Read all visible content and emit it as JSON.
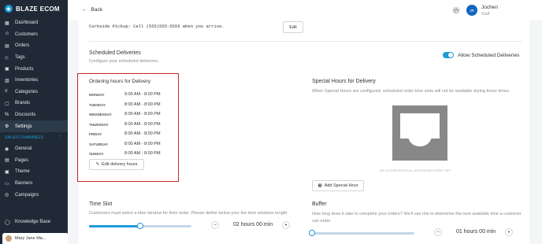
{
  "brand": {
    "name": "BLAZE ECOM"
  },
  "sidebar": {
    "items": [
      {
        "label": "Dashboard",
        "icon": "dashboard-icon"
      },
      {
        "label": "Customers",
        "icon": "customers-icon"
      },
      {
        "label": "Orders",
        "icon": "orders-icon"
      },
      {
        "label": "Tags",
        "icon": "tags-icon"
      },
      {
        "label": "Products",
        "icon": "products-icon"
      },
      {
        "label": "Inventories",
        "icon": "inventories-icon"
      },
      {
        "label": "Categories",
        "icon": "categories-icon"
      },
      {
        "label": "Brands",
        "icon": "brands-icon"
      },
      {
        "label": "Discounts",
        "icon": "discounts-icon"
      },
      {
        "label": "Settings",
        "icon": "settings-icon",
        "active": true
      }
    ],
    "sales_channels_label": "SALES CHANNELS",
    "channel_items": [
      {
        "label": "General"
      },
      {
        "label": "Pages"
      },
      {
        "label": "Theme"
      },
      {
        "label": "Banners"
      },
      {
        "label": "Campaigns"
      }
    ],
    "knowledge_base": "Knowledge Base",
    "user_name": "Mary Jane Ma..."
  },
  "topbar": {
    "back_label": "Back",
    "avatar_initials": "JR",
    "user_name": "Jochen",
    "user_role": "Staff"
  },
  "pickup": {
    "text": "Curbside Pickup: Call (555)555-5555 when you arrive.",
    "edit_label": "Edit"
  },
  "scheduled": {
    "title": "Scheduled Deliveries",
    "subtitle": "Configure your scheduled deliveries.",
    "toggle_label": "Allow Scheduled Deliveries",
    "toggle_on": true
  },
  "ordering_hours": {
    "title": "Ordering hours for Delivery",
    "rows": [
      {
        "day": "MONDAY",
        "hours": "9:00 AM - 8:00 PM"
      },
      {
        "day": "TUESDAY",
        "hours": "8:00 AM - 8:00 PM"
      },
      {
        "day": "WEDNESDAY",
        "hours": "8:00 AM - 8:00 PM"
      },
      {
        "day": "THURSDAY",
        "hours": "8:00 AM - 8:00 PM"
      },
      {
        "day": "FRIDAY",
        "hours": "8:00 AM - 8:00 PM"
      },
      {
        "day": "SATURDAY",
        "hours": "8:00 AM - 8:00 PM"
      },
      {
        "day": "SUNDAY",
        "hours": "8:00 AM - 8:00 PM"
      }
    ],
    "edit_label": "Edit delivery hours"
  },
  "special_hours": {
    "title": "Special Hours for Delivery",
    "subtitle": "When Special Hours are configured, scheduled order time slots will not be available during those times.",
    "empty_caption": "NO STORE/SPECIAL HOURS/DELIVERY SET",
    "add_label": "Add Special Hour"
  },
  "time_slot": {
    "title": "Time Slot",
    "subtitle": "Customers must select a time window for their order. Please define below your the time windows length.",
    "value": "02 hours 00 min",
    "level": 0.5
  },
  "buffer": {
    "title": "Buffer",
    "subtitle": "How long does it take to complete your orders? We'll use this to determine the next available time a customer can order.",
    "value": "01 hours 00 min",
    "level": 0.0
  }
}
